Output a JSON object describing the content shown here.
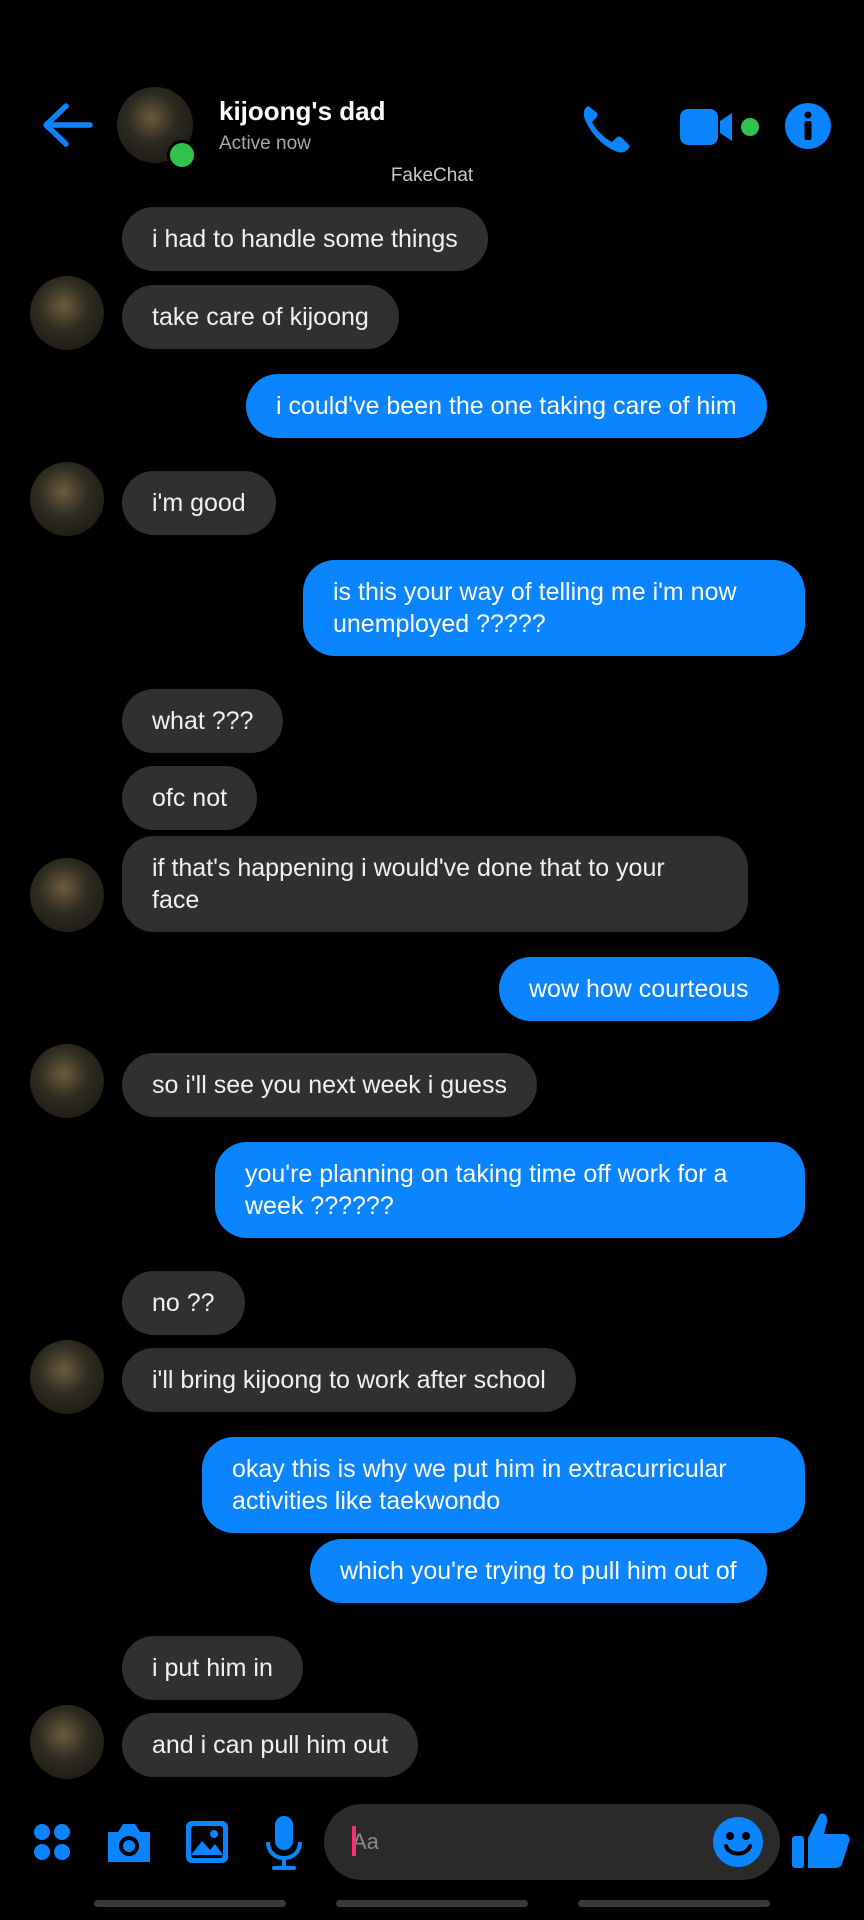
{
  "header": {
    "contact_name": "kijoong's dad",
    "contact_status": "Active now",
    "watermark": "FakeChat",
    "accent_color": "#0a84ff",
    "online_color": "#31c24d"
  },
  "messages": [
    {
      "from": "them",
      "text": "i had to handle some things"
    },
    {
      "from": "them",
      "text": "take care of kijoong"
    },
    {
      "from": "me",
      "text": "i could've been the one taking care of him"
    },
    {
      "from": "them",
      "text": "i'm good"
    },
    {
      "from": "me",
      "text": "is this your way of telling me i'm now unemployed ?????"
    },
    {
      "from": "them",
      "text": "what ???"
    },
    {
      "from": "them",
      "text": "ofc not"
    },
    {
      "from": "them",
      "text": "if that's happening i would've done that to your face"
    },
    {
      "from": "me",
      "text": "wow how courteous"
    },
    {
      "from": "them",
      "text": "so i'll see you next week i guess"
    },
    {
      "from": "me",
      "text": "you're planning on taking time off work for a week ??????"
    },
    {
      "from": "them",
      "text": "no ??"
    },
    {
      "from": "them",
      "text": "i'll bring kijoong to work after school"
    },
    {
      "from": "me",
      "text": "okay this is why we put him in extracurricular activities like taekwondo"
    },
    {
      "from": "me",
      "text": "which you're trying to pull him out of"
    },
    {
      "from": "them",
      "text": "i put him in"
    },
    {
      "from": "them",
      "text": "and i can pull him out"
    }
  ],
  "composer": {
    "placeholder": "Aa",
    "icons": [
      "apps-icon",
      "camera-icon",
      "gallery-icon",
      "microphone-icon",
      "emoji-icon",
      "like-icon"
    ]
  }
}
